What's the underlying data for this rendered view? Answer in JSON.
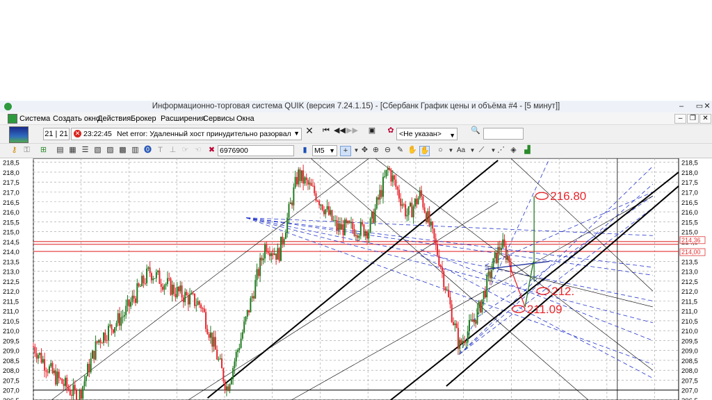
{
  "window": {
    "title": "Информационно-торговая система QUIK (версия 7.24.1.15) - [Сбербанк График цены и объёма #4 - [5 минут]]",
    "controls": [
      "–",
      "▭",
      "✕"
    ]
  },
  "menu": {
    "items": [
      "Система",
      "Создать окно",
      "Действия",
      "Брокер",
      "Расширения",
      "Сервисы",
      "Окна"
    ],
    "mdi_controls": [
      "–",
      "❐",
      "✕"
    ]
  },
  "toolbar": {
    "counter": "21 | 21",
    "message_time": "23:22:45",
    "message_text": "Net error: Удаленный хост принудительно разорвал существующее п",
    "account_combo": "<Не указан>"
  },
  "toolbar2": {
    "instrument_code": "6976900",
    "interval": "M5",
    "text_tool": "Aa"
  },
  "chart_data": {
    "type": "candlestick",
    "yaxis_ticks": [
      "218,5",
      "218,0",
      "217,5",
      "217,0",
      "216,5",
      "216,0",
      "215,5",
      "215,0",
      "214,5",
      "214,0",
      "213,5",
      "213,0",
      "212,5",
      "212,0",
      "211,5",
      "211,0",
      "210,5",
      "210,0",
      "209,5",
      "209,0",
      "208,5",
      "208,0",
      "207,5",
      "207,0",
      "206,5"
    ],
    "ylim": [
      206.5,
      218.7
    ],
    "price_tags": [
      "214,36",
      "214,00"
    ],
    "horizontal_levels": [
      214.5,
      214.36,
      214.0,
      207.0
    ],
    "annotations": [
      {
        "text": "216.80",
        "value": 216.8,
        "color": "#e8262c"
      },
      {
        "text": "212.",
        "value": 212.0,
        "color": "#e8262c"
      },
      {
        "text": "211.09",
        "value": 211.09,
        "color": "#e8262c"
      }
    ],
    "price_path_anchors": [
      {
        "t": 0,
        "p": 209.2
      },
      {
        "t": 0.03,
        "p": 207.8
      },
      {
        "t": 0.07,
        "p": 206.6
      },
      {
        "t": 0.1,
        "p": 209.5
      },
      {
        "t": 0.14,
        "p": 210.8
      },
      {
        "t": 0.18,
        "p": 213.0
      },
      {
        "t": 0.22,
        "p": 212.0
      },
      {
        "t": 0.26,
        "p": 211.3
      },
      {
        "t": 0.3,
        "p": 207.1
      },
      {
        "t": 0.33,
        "p": 210.6
      },
      {
        "t": 0.36,
        "p": 214.4
      },
      {
        "t": 0.38,
        "p": 213.8
      },
      {
        "t": 0.41,
        "p": 217.9
      },
      {
        "t": 0.44,
        "p": 216.8
      },
      {
        "t": 0.47,
        "p": 215.2
      },
      {
        "t": 0.52,
        "p": 215.1
      },
      {
        "t": 0.55,
        "p": 218.2
      },
      {
        "t": 0.58,
        "p": 215.8
      },
      {
        "t": 0.6,
        "p": 216.9
      },
      {
        "t": 0.63,
        "p": 213.5
      },
      {
        "t": 0.66,
        "p": 209.2
      },
      {
        "t": 0.69,
        "p": 211.0
      },
      {
        "t": 0.71,
        "p": 213.1
      },
      {
        "t": 0.725,
        "p": 214.4
      },
      {
        "t": 0.74,
        "p": 213.4
      }
    ],
    "colors": {
      "up": "#1f7a1f",
      "down": "#e8262c",
      "trend": "#000000",
      "fan": "#2233cc",
      "level": "#e03030"
    }
  }
}
